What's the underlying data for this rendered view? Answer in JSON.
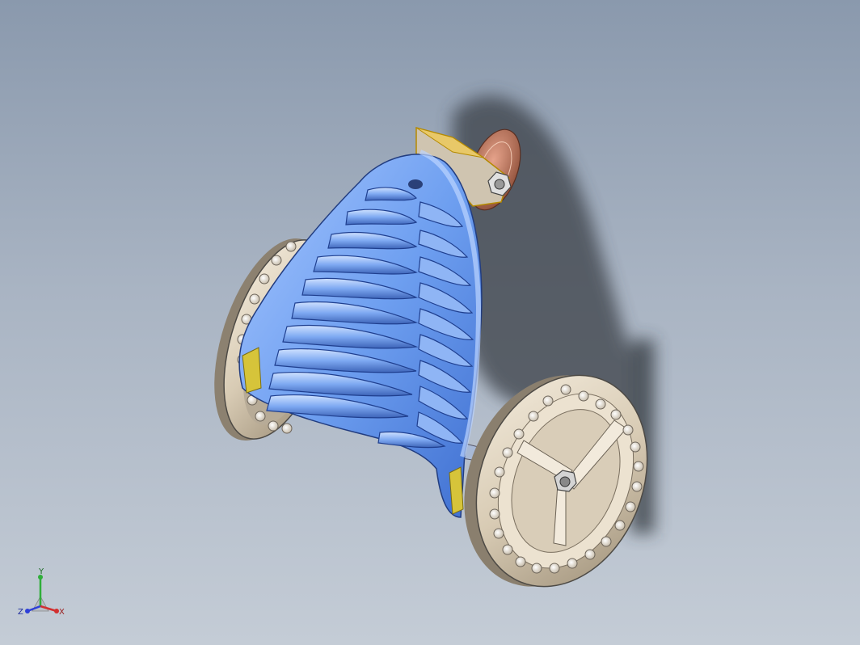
{
  "viewport": {
    "background_top": "#8a99ad",
    "background_bottom": "#c4ccd6",
    "model_color": "#6e9ff0",
    "highlight_color": "#d6c43a",
    "bracket_color": "#e8c868"
  },
  "triad": {
    "x_label": "X",
    "y_label": "Y",
    "z_label": "Z",
    "x_color": "#d23030",
    "y_color": "#2fae3a",
    "z_color": "#2d3fd8"
  }
}
